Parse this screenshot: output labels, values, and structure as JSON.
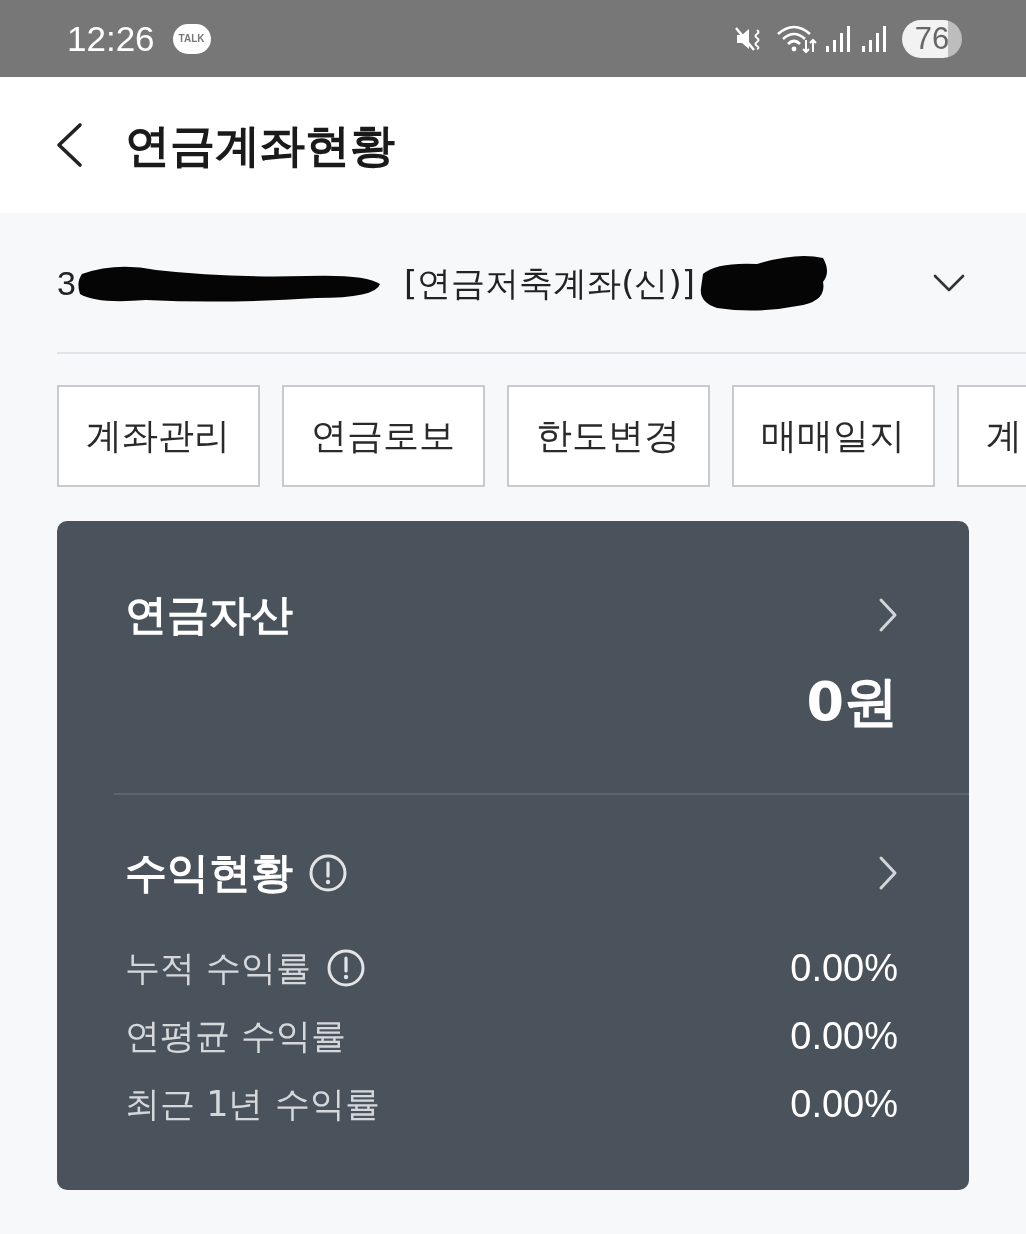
{
  "status_bar": {
    "time": "12:26",
    "notification_badge": "TALK",
    "battery": "76"
  },
  "header": {
    "title": "연금계좌현황"
  },
  "account_selector": {
    "number_visible": "3",
    "account_type": "[연금저축계좌(신)]",
    "expanded": false
  },
  "menu_buttons": [
    "계좌관리",
    "연금로보",
    "한도변경",
    "매매일지",
    "계"
  ],
  "asset_card": {
    "title": "연금자산",
    "amount": "0원"
  },
  "returns": {
    "title": "수익현황",
    "rows": [
      {
        "label": "누적 수익률",
        "info": true,
        "value": "0.00%"
      },
      {
        "label": "연평균 수익률",
        "info": false,
        "value": "0.00%"
      },
      {
        "label": "최근 1년 수익률",
        "info": false,
        "value": "0.00%"
      }
    ]
  }
}
